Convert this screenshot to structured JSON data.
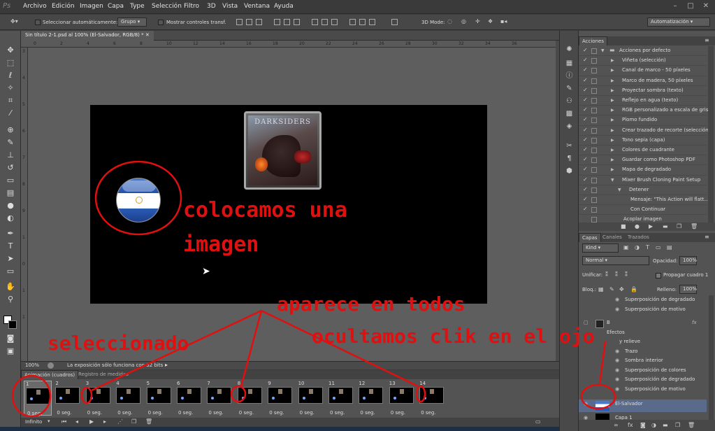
{
  "menubar": {
    "logo": "Ps",
    "items": [
      "Archivo",
      "Edición",
      "Imagen",
      "Capa",
      "Type",
      "Selección",
      "Filtro",
      "3D",
      "Vista",
      "Ventana",
      "Ayuda"
    ]
  },
  "options": {
    "auto_select_label": "Seleccionar automáticamente:",
    "auto_select_value": "Grupo",
    "show_transform_label": "Mostrar controles transf.",
    "mode_3d_label": "3D Mode:",
    "workspace": "Automatización"
  },
  "document": {
    "tab_title": "Sin título 2-1.psd al 100% (El-Salvador, RGB/8) *",
    "ruler_top": [
      "0",
      "2",
      "4",
      "6",
      "8",
      "10",
      "12",
      "14",
      "16",
      "18",
      "20",
      "22",
      "24",
      "26",
      "28",
      "30",
      "32",
      "34",
      "36"
    ],
    "ruler_left": [
      "3",
      "4",
      "5",
      "6",
      "7",
      "8",
      "9",
      "1",
      "0",
      "1",
      "1"
    ]
  },
  "canvas": {
    "game_logo": "DARKSIDERS"
  },
  "status": {
    "zoom": "100%",
    "message": "La exposición sólo funciona con 32 bits"
  },
  "animation": {
    "tabs": [
      "Animación (cuadros)",
      "Registro de medidas"
    ],
    "frames": [
      {
        "num": "1",
        "time": "0 seg."
      },
      {
        "num": "2",
        "time": "0 seg."
      },
      {
        "num": "3",
        "time": "0 seg."
      },
      {
        "num": "4",
        "time": "0 seg."
      },
      {
        "num": "5",
        "time": "0 seg."
      },
      {
        "num": "6",
        "time": "0 seg."
      },
      {
        "num": "7",
        "time": "0 seg."
      },
      {
        "num": "8",
        "time": "0 seg."
      },
      {
        "num": "9",
        "time": "0 seg."
      },
      {
        "num": "10",
        "time": "0 seg."
      },
      {
        "num": "11",
        "time": "0 seg."
      },
      {
        "num": "12",
        "time": "0 seg."
      },
      {
        "num": "13",
        "time": "0 seg."
      },
      {
        "num": "14",
        "time": "0 seg."
      }
    ],
    "loop": "Infinito"
  },
  "actions": {
    "tab": "Acciones",
    "items": [
      "Acciones por defecto",
      "Viñeta (selección)",
      "Canal de marco - 50 píxeles",
      "Marco de madera, 50 píxeles",
      "Proyectar sombra (texto)",
      "Reflejo en agua (texto)",
      "RGB personalizado a escala de grises",
      "Plomo fundido",
      "Crear trazado de recorte (selección)",
      "Tono sepia (capa)",
      "Colores de cuadrante",
      "Guardar como Photoshop PDF",
      "Mapa de degradado",
      "Mixer Brush Cloning Paint Setup",
      "Detener",
      "Mensaje: \"This Action will flatt...",
      "Con Continuar",
      "Acoplar imagen"
    ]
  },
  "layers": {
    "tabs": [
      "Capas",
      "Canales",
      "Trazados"
    ],
    "kind": "Kind",
    "blend": "Normal",
    "opacity_label": "Opacidad:",
    "opacity": "100%",
    "unify_label": "Unificar:",
    "propagate_label": "Propagar cuadro 1",
    "lock_label": "Bloq.:",
    "fill_label": "Relleno:",
    "fill": "100%",
    "rows": [
      "Superposición de degradado",
      "Superposición de motivo",
      "B",
      "Efectos",
      "y relieve",
      "Trazo",
      "Sombra interior",
      "Superposición de colores",
      "Superposición de degradado",
      "Superposición de motivo",
      "El-Salvador",
      "Capa 1"
    ],
    "fx": "fx"
  },
  "annotations": {
    "place_image_1": "colocamos una",
    "place_image_2": "imagen",
    "appears_all": "aparece en todos",
    "selected": "seleccionado",
    "hide_eye": "ocultamos clik en el ojo"
  },
  "colors": {
    "annotation_red": "#e01010",
    "canvas": "#000000",
    "ui_dark": "#535353"
  }
}
